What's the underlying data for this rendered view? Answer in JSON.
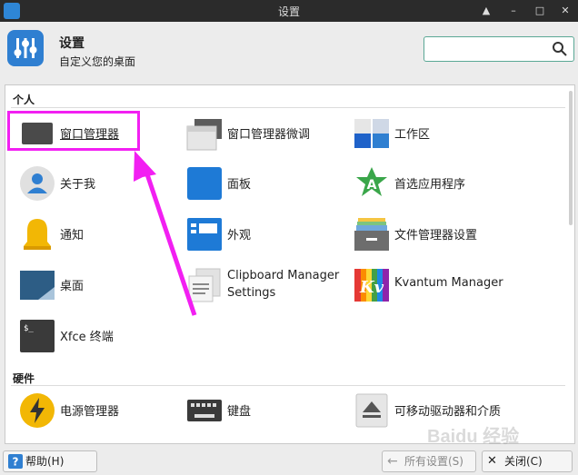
{
  "window": {
    "title": "设置"
  },
  "header": {
    "title": "设置",
    "subtitle": "自定义您的桌面",
    "search": {
      "value": "",
      "placeholder": ""
    }
  },
  "categories": [
    {
      "name": "个人",
      "items": [
        {
          "label": "窗口管理器",
          "icon": "window-manager-icon"
        },
        {
          "label": "窗口管理器微调",
          "icon": "window-tweaks-icon"
        },
        {
          "label": "工作区",
          "icon": "workspaces-icon"
        },
        {
          "label": "关于我",
          "icon": "user-icon"
        },
        {
          "label": "面板",
          "icon": "panel-icon"
        },
        {
          "label": "首选应用程序",
          "icon": "preferred-apps-icon"
        },
        {
          "label": "通知",
          "icon": "bell-icon"
        },
        {
          "label": "外观",
          "icon": "appearance-icon"
        },
        {
          "label": "文件管理器设置",
          "icon": "file-manager-icon"
        },
        {
          "label": "桌面",
          "icon": "desktop-icon"
        },
        {
          "label": "Clipboard Manager Settings",
          "icon": "clipboard-icon"
        },
        {
          "label": "Kvantum Manager",
          "icon": "kvantum-icon"
        },
        {
          "label": "Xfce 终端",
          "icon": "terminal-icon"
        }
      ]
    },
    {
      "name": "硬件",
      "items": [
        {
          "label": "电源管理器",
          "icon": "power-icon"
        },
        {
          "label": "键盘",
          "icon": "keyboard-icon"
        },
        {
          "label": "可移动驱动器和介质",
          "icon": "eject-icon"
        }
      ]
    }
  ],
  "buttons": {
    "help": "帮助(H)",
    "all_settings": "所有设置(S)",
    "close": "关闭(C)"
  },
  "watermark": "Baidu 经验",
  "colors": {
    "highlight": "#f21ff2",
    "accent": "#2f7fd1",
    "search_border": "#5aa895"
  }
}
